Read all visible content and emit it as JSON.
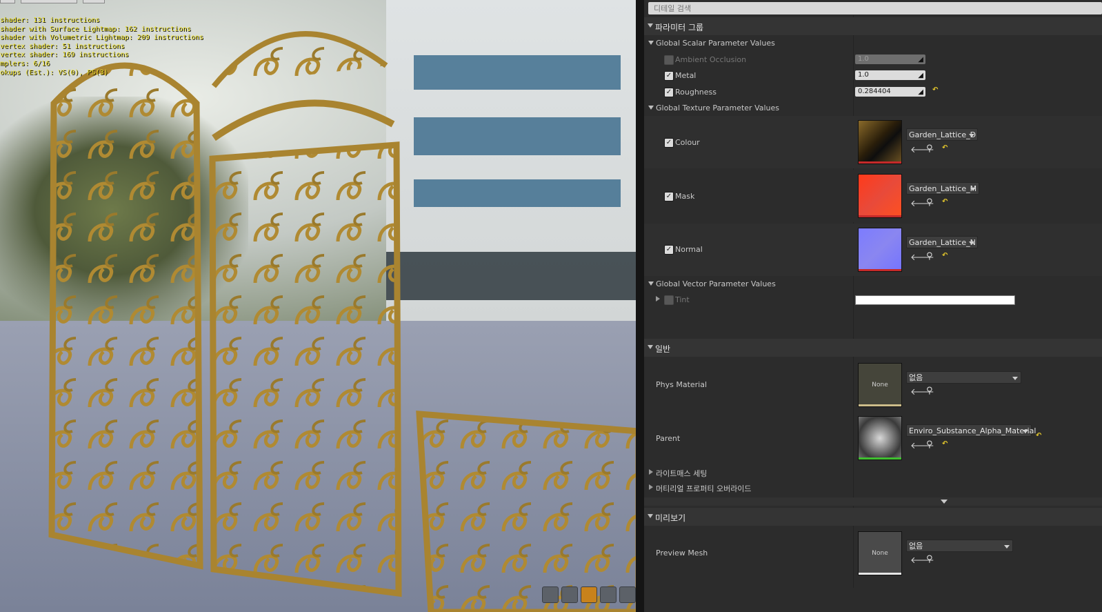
{
  "viewport": {
    "stats": [
      "shader: 131 instructions",
      "shader with Surface Lightmap: 162 instructions",
      "shader with Volumetric Lightmap: 209 instructions",
      "vertex shader: 51 instructions",
      "vertex shader: 169 instructions",
      "mplers: 6/16",
      "okups (Est.): VS(0), PS(3)"
    ],
    "preview_tools": [
      "cylinder-icon",
      "sphere-icon",
      "plane-icon",
      "cube-icon",
      "teapot-icon"
    ],
    "active_tool": "plane-icon"
  },
  "details": {
    "search_placeholder": "디테일 검색",
    "param_group": {
      "title": "파라미터 그룹",
      "scalar": {
        "title": "Global Scalar Parameter Values",
        "items": [
          {
            "label": "Ambient Occlusion",
            "value": "1.0",
            "checked": false
          },
          {
            "label": "Metal",
            "value": "1.0",
            "checked": true
          },
          {
            "label": "Roughness",
            "value": "0.284404",
            "checked": true
          }
        ]
      },
      "texture": {
        "title": "Global Texture Parameter Values",
        "items": [
          {
            "label": "Colour",
            "asset": "Garden_Lattice_D",
            "checked": true
          },
          {
            "label": "Mask",
            "asset": "Garden_Lattice_M",
            "checked": true
          },
          {
            "label": "Normal",
            "asset": "Garden_Lattice_N",
            "checked": true
          }
        ]
      },
      "vector": {
        "title": "Global Vector Parameter Values",
        "items": [
          {
            "label": "Tint",
            "checked": false,
            "color": "#ffffff"
          }
        ]
      }
    },
    "general": {
      "title": "일반",
      "phys_material": {
        "label": "Phys Material",
        "thumb_text": "None",
        "value": "없음"
      },
      "parent": {
        "label": "Parent",
        "value": "Enviro_Substance_Alpha_Material"
      },
      "lightmass": "라이트매스 세팅",
      "overrides": "머티리얼 프로퍼티 오버라이드"
    },
    "preview": {
      "title": "미리보기",
      "mesh": {
        "label": "Preview Mesh",
        "thumb_text": "None",
        "value": "없음"
      }
    }
  }
}
